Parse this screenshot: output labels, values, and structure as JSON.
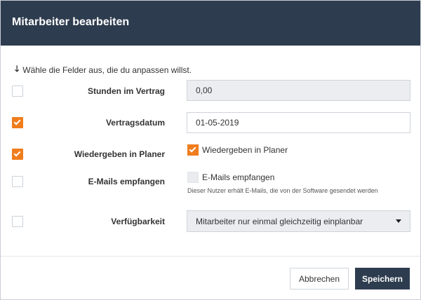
{
  "dialog": {
    "title": "Mitarbeiter bearbeiten",
    "hint": "Wähle die Felder aus, die du anpassen willst."
  },
  "fields": {
    "hours": {
      "label": "Stunden im Vertrag",
      "value": "0,00",
      "selected": false,
      "disabled": true
    },
    "contract_date": {
      "label": "Vertragsdatum",
      "value": "01-05-2019",
      "selected": true
    },
    "display_in_plan": {
      "label": "Wiedergeben in Planer",
      "checkbox_label": "Wiedergeben in Planer",
      "selected": true,
      "checked": true
    },
    "receive_emails": {
      "label": "E-Mails empfangen",
      "checkbox_label": "E-Mails empfangen",
      "selected": false,
      "checked": false,
      "help": "Dieser Nutzer erhält E-Mails, die von der Software gesendet werden"
    },
    "availability": {
      "label": "Verfügbarkeit",
      "value": "Mitarbeiter nur einmal gleichzeitig einplanbar",
      "selected": false
    }
  },
  "buttons": {
    "cancel": "Abbrechen",
    "save": "Speichern"
  },
  "colors": {
    "header": "#2e3c4f",
    "accent": "#f07d1c",
    "save_button": "#2e3c4f"
  }
}
